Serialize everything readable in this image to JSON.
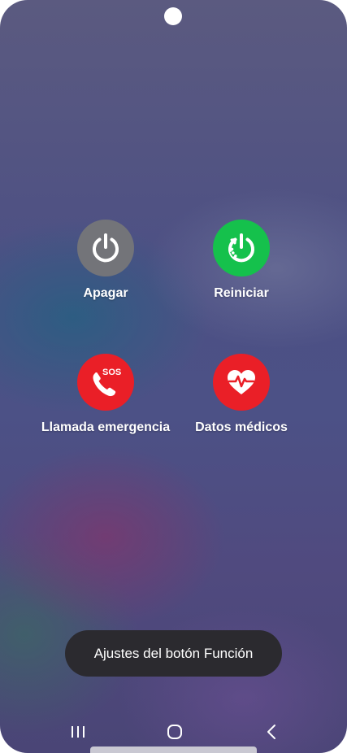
{
  "power_menu": {
    "options": [
      {
        "label": "Apagar",
        "icon": "power-icon",
        "color": "#737479"
      },
      {
        "label": "Reiniciar",
        "icon": "restart-icon",
        "color": "#15c14c"
      },
      {
        "label": "Llamada emergencia",
        "icon": "sos-phone-icon",
        "color": "#ea1f27",
        "badge": "SOS"
      },
      {
        "label": "Datos médicos",
        "icon": "heart-pulse-icon",
        "color": "#ea1f27"
      }
    ],
    "side_key_button_label": "Ajustes del botón Función"
  },
  "navigation_bar": {
    "buttons": [
      "recents-icon",
      "home-icon",
      "back-icon"
    ]
  }
}
